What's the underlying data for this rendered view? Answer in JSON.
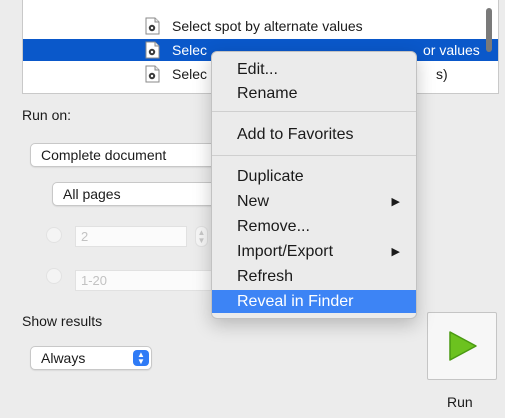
{
  "list": {
    "rows": [
      {
        "label": "Select spot by alternate values",
        "tail": ""
      },
      {
        "label": "Selec",
        "tail": "or values"
      },
      {
        "label": "Selec",
        "tail": "s)"
      }
    ]
  },
  "run_on": {
    "label": "Run on:",
    "scope_value": "Complete document",
    "pages_value": "All pages",
    "single_page_value": "2",
    "range_value": "1-20"
  },
  "show_results": {
    "label": "Show results",
    "value": "Always"
  },
  "run_button": {
    "label": "Run"
  },
  "context_menu": {
    "items": {
      "edit": "Edit...",
      "rename": "Rename",
      "add_favorites": "Add to Favorites",
      "duplicate": "Duplicate",
      "new": "New",
      "remove": "Remove...",
      "import_export": "Import/Export",
      "refresh": "Refresh",
      "reveal": "Reveal in Finder"
    },
    "submenu_arrow": "▶"
  },
  "colors": {
    "selection": "#0a58ca",
    "menu_highlight": "#3d84f5",
    "run_triangle": "#6cc21f"
  }
}
